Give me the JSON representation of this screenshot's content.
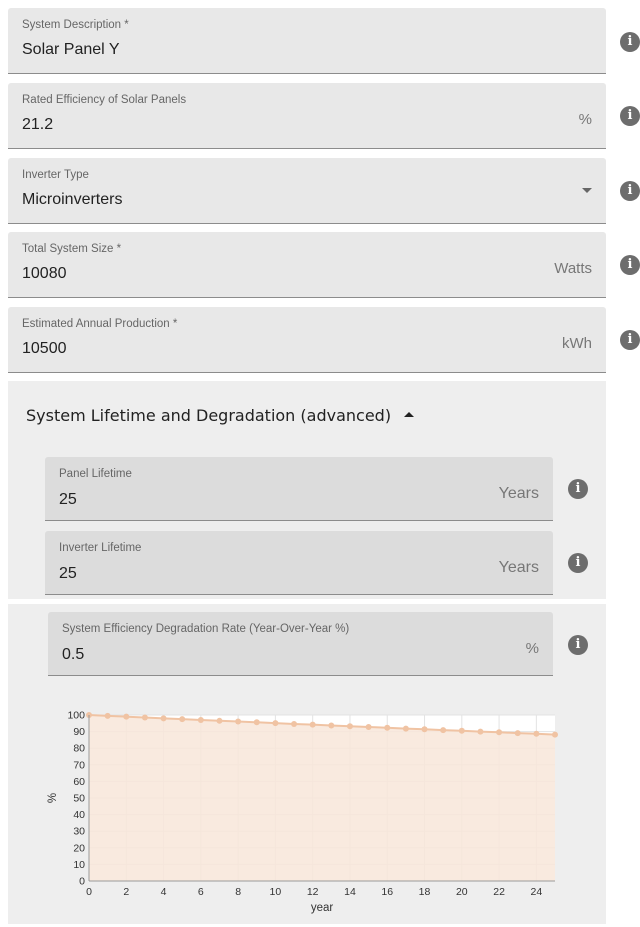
{
  "fields": {
    "system_description": {
      "label": "System Description *",
      "value": "Solar Panel Y"
    },
    "rated_efficiency": {
      "label": "Rated Efficiency of Solar Panels",
      "value": "21.2",
      "suffix": "%"
    },
    "inverter_type": {
      "label": "Inverter Type",
      "value": "Microinverters"
    },
    "total_system_size": {
      "label": "Total System Size *",
      "value": "10080",
      "suffix": "Watts"
    },
    "annual_production": {
      "label": "Estimated Annual Production *",
      "value": "10500",
      "suffix": "kWh"
    }
  },
  "advanced": {
    "title": "System Lifetime and Degradation (advanced)",
    "panel_lifetime": {
      "label": "Panel Lifetime",
      "value": "25",
      "suffix": "Years"
    },
    "inverter_lifetime": {
      "label": "Inverter Lifetime",
      "value": "25",
      "suffix": "Years"
    },
    "degradation_rate": {
      "label": "System Efficiency Degradation Rate (Year-Over-Year %)",
      "value": "0.5",
      "suffix": "%"
    }
  },
  "info_icon_glyph": "i",
  "colors": {
    "line": "#f0c3a3",
    "fill": "#f8e6d9",
    "field_bg": "#e8e8e8",
    "panel_bg": "#eeeeee",
    "icon": "#6d6d6d"
  },
  "chart_data": {
    "type": "area",
    "title": "",
    "xlabel": "year",
    "ylabel": "%",
    "xlim": [
      0,
      25
    ],
    "ylim": [
      0,
      100
    ],
    "x_ticks": [
      0,
      2,
      4,
      6,
      8,
      10,
      12,
      14,
      16,
      18,
      20,
      22,
      24
    ],
    "y_ticks": [
      0,
      10,
      20,
      30,
      40,
      50,
      60,
      70,
      80,
      90,
      100
    ],
    "grid": true,
    "series": [
      {
        "x": [
          0,
          1,
          2,
          3,
          4,
          5,
          6,
          7,
          8,
          9,
          10,
          11,
          12,
          13,
          14,
          15,
          16,
          17,
          18,
          19,
          20,
          21,
          22,
          23,
          24,
          25
        ],
        "values": [
          100,
          99.5,
          99.0,
          98.5,
          98.0,
          97.5,
          97.0,
          96.5,
          96.1,
          95.6,
          95.1,
          94.6,
          94.2,
          93.7,
          93.2,
          92.8,
          92.3,
          91.8,
          91.4,
          90.9,
          90.5,
          90.0,
          89.6,
          89.1,
          88.7,
          88.2
        ]
      }
    ]
  }
}
